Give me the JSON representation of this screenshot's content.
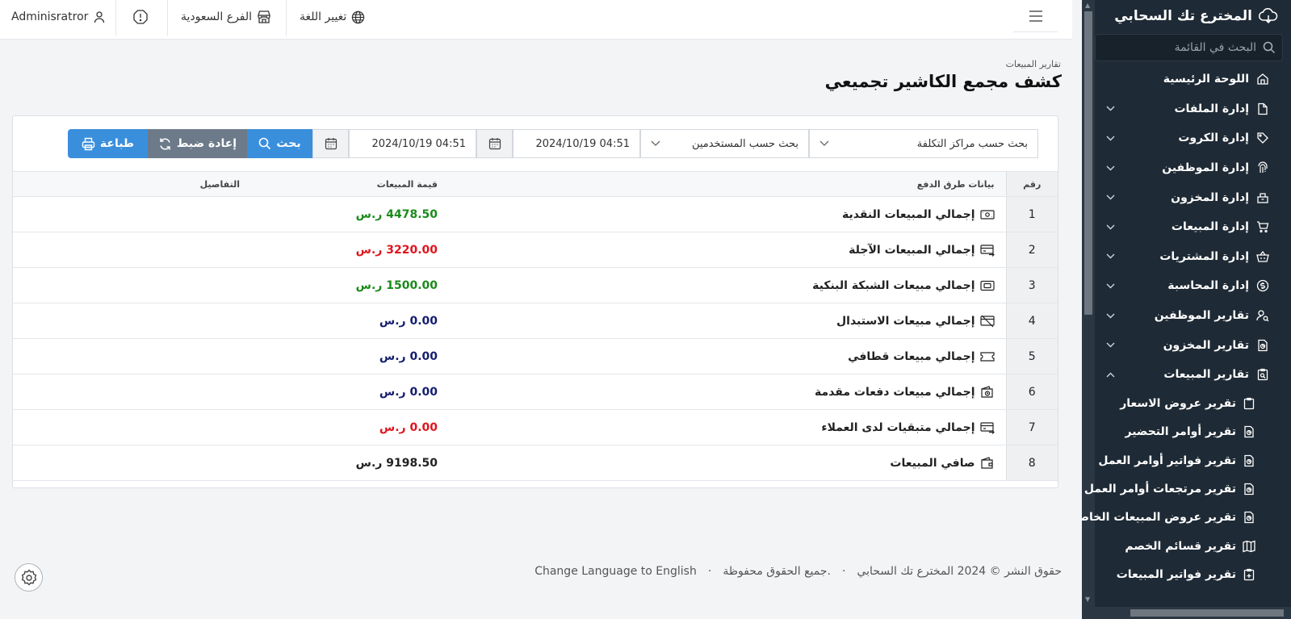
{
  "sidebar": {
    "brand": "المخترع تك السحابي",
    "search_placeholder": "البحث في القائمة",
    "items": [
      {
        "label": "اللوحة الرئيسية",
        "icon": "home-icon",
        "chevron": ""
      },
      {
        "label": "إدارة الملفات",
        "icon": "file-icon",
        "chevron": "expand"
      },
      {
        "label": "إدارة الكروت",
        "icon": "tag-icon",
        "chevron": "expand"
      },
      {
        "label": "إدارة الموظفين",
        "icon": "fingerprint-icon",
        "chevron": "expand"
      },
      {
        "label": "إدارة المخزون",
        "icon": "box-icon",
        "chevron": "expand"
      },
      {
        "label": "إدارة المبيعات",
        "icon": "cart-icon",
        "chevron": "expand"
      },
      {
        "label": "إدارة المشتريات",
        "icon": "basket-icon",
        "chevron": "expand"
      },
      {
        "label": "إدارة المحاسبة",
        "icon": "coin-icon",
        "chevron": "expand"
      },
      {
        "label": "تقارير الموظفين",
        "icon": "user-search-icon",
        "chevron": "expand"
      },
      {
        "label": "تقارير المخزون",
        "icon": "report-icon",
        "chevron": "expand"
      },
      {
        "label": "تقارير المبيعات",
        "icon": "clipboard-search-icon",
        "chevron": "collapse"
      }
    ],
    "subitems": [
      {
        "label": "تقرير عروض الاسعار",
        "icon": "clipboard-icon"
      },
      {
        "label": "تقرير أوامر التحضير",
        "icon": "report-icon"
      },
      {
        "label": "تقرير فواتير أوامر العمل",
        "icon": "report-icon"
      },
      {
        "label": "تقرير مرتجعات أوامر العمل",
        "icon": "report-icon"
      },
      {
        "label": "تقرير عروض المبيعات الخاصة",
        "icon": "report-icon"
      },
      {
        "label": "تقرير قسائم الخصم",
        "icon": "map-icon"
      },
      {
        "label": "تقرير فواتير المبيعات",
        "icon": "clipboard-plus-icon"
      }
    ]
  },
  "topbar": {
    "user": "Adminisratror",
    "branch": "الفرع السعودية",
    "language": "تغيير اللغة"
  },
  "page": {
    "breadcrumb": "تقارير المبيعات",
    "title": "كشف مجمع الكاشير تجميعي"
  },
  "filters": {
    "cost_center": "بحث حسب مراكز التكلفة",
    "users": "بحث حسب المستخدمين",
    "date_from": "2024/10/19 04:51",
    "date_to": "2024/10/19 04:51",
    "search_label": "بحث",
    "reset_label": "إعادة ضبط",
    "print_label": "طباعة"
  },
  "table": {
    "headers": {
      "num": "رقم",
      "label": "بيانات طرق الدفع",
      "value": "قيمة المبيعات",
      "details": "التفاصيل"
    },
    "currency": "ر.س",
    "rows": [
      {
        "num": "1",
        "label": "إجمالي المبيعات النقدية",
        "value": "4478.50",
        "color": "#1a8a1a",
        "icon": "money-icon"
      },
      {
        "num": "2",
        "label": "إجمالي المبيعات الآجلة",
        "value": "3220.00",
        "color": "#e0141e",
        "icon": "credit-card-arrow-icon"
      },
      {
        "num": "3",
        "label": "إجمالي مبيعات الشبكة البنكية",
        "value": "1500.00",
        "color": "#1a8a1a",
        "icon": "bank-card-icon"
      },
      {
        "num": "4",
        "label": "إجمالي مبيعات الاستبدال",
        "value": "0.00",
        "color": "#141e6e",
        "icon": "card-off-icon"
      },
      {
        "num": "5",
        "label": "إجمالي مبيعات قطافي",
        "value": "0.00",
        "color": "#141e6e",
        "icon": "ticket-icon"
      },
      {
        "num": "6",
        "label": "إجمالي مبيعات دفعات مقدمة",
        "value": "0.00",
        "color": "#141e6e",
        "icon": "wallet-clock-icon"
      },
      {
        "num": "7",
        "label": "إجمالي متبقيات لدى العملاء",
        "value": "0.00",
        "color": "#e0141e",
        "icon": "credit-card-arrow-icon"
      },
      {
        "num": "8",
        "label": "صافي المبيعات",
        "value": "9198.50",
        "color": "#222222",
        "icon": "wallet-icon"
      }
    ]
  },
  "footer": {
    "copyright": "حقوق النشر © 2024 المخترع تك السحابي",
    "rights": "جميع الحقوق محفوظة.",
    "dot": "·",
    "change_lang": "Change Language to English"
  }
}
